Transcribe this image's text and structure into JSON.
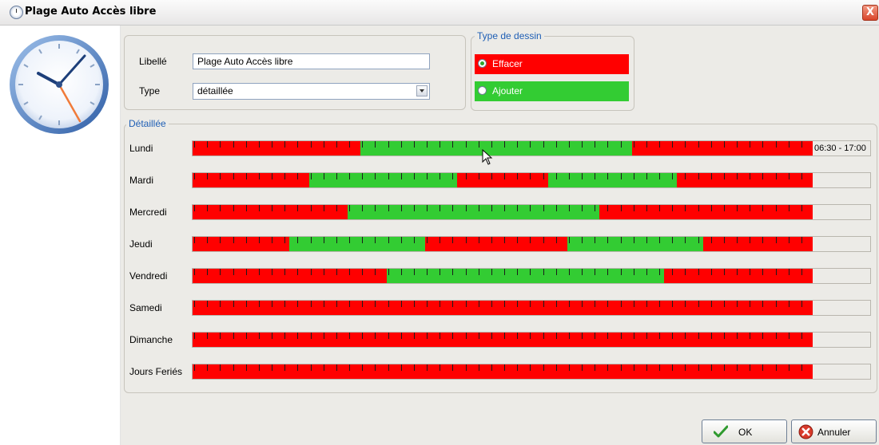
{
  "window": {
    "title": "Plage Auto Accès libre",
    "close_label": "X"
  },
  "form": {
    "libelle_label": "Libellé",
    "libelle_value": "Plage Auto Accès libre",
    "type_label": "Type",
    "type_value": "détaillée"
  },
  "type_dessin": {
    "legend": "Type de dessin",
    "options": [
      {
        "label": "Effacer",
        "checked": true,
        "color": "#ff0000"
      },
      {
        "label": "Ajouter",
        "checked": false,
        "color": "#33cc33"
      }
    ]
  },
  "detail": {
    "legend": "Détaillée",
    "colors": {
      "off": "#ff0000",
      "on": "#33cc33"
    },
    "days": [
      {
        "label": "Lundi",
        "ranges": [
          [
            6.5,
            17.0
          ]
        ],
        "range_text": "06:30 - 17:00"
      },
      {
        "label": "Mardi",
        "ranges": [
          [
            4.5,
            10.25
          ],
          [
            13.75,
            18.75
          ]
        ],
        "range_text": ""
      },
      {
        "label": "Mercredi",
        "ranges": [
          [
            6.0,
            15.75
          ]
        ],
        "range_text": ""
      },
      {
        "label": "Jeudi",
        "ranges": [
          [
            3.75,
            9.0
          ],
          [
            14.5,
            19.75
          ]
        ],
        "range_text": ""
      },
      {
        "label": "Vendredi",
        "ranges": [
          [
            7.5,
            18.25
          ]
        ],
        "range_text": ""
      },
      {
        "label": "Samedi",
        "ranges": [],
        "range_text": ""
      },
      {
        "label": "Dimanche",
        "ranges": [],
        "range_text": ""
      },
      {
        "label": "Jours Feriés",
        "ranges": [],
        "range_text": ""
      }
    ]
  },
  "buttons": {
    "ok": "OK",
    "cancel": "Annuler"
  },
  "icons": {
    "window": "clock-icon",
    "ok": "checkmark-icon",
    "cancel": "cancel-icon"
  }
}
